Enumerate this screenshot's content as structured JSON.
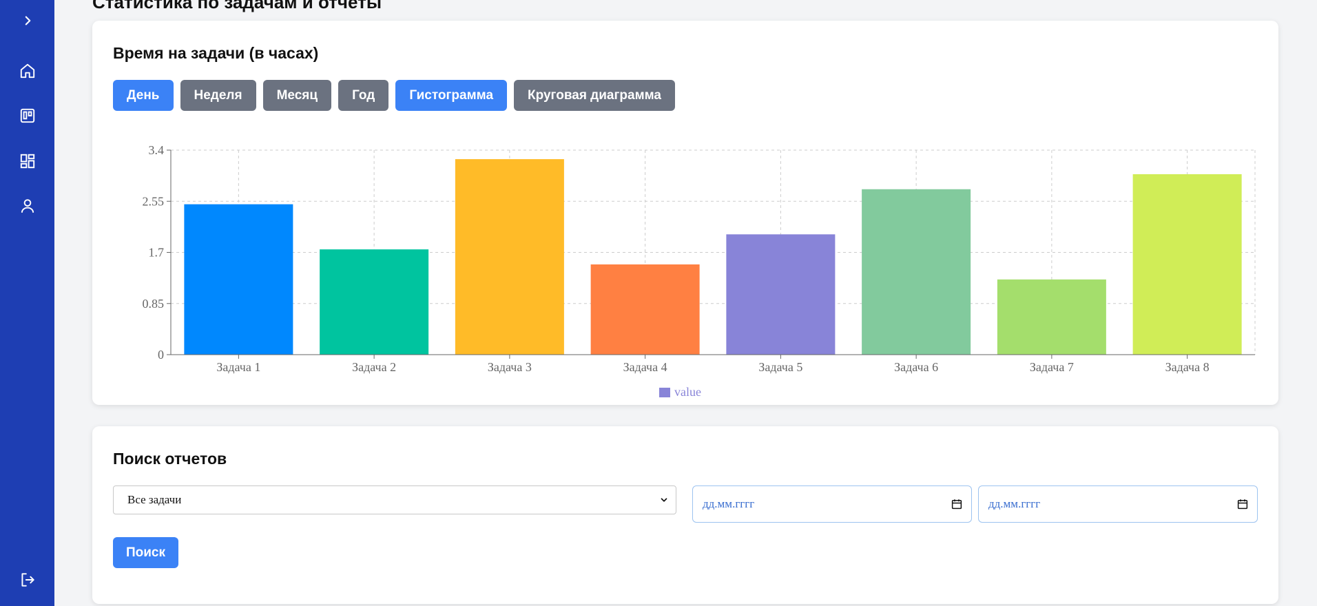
{
  "sidebar": {
    "items": [
      {
        "icon": "chevron-right-icon"
      },
      {
        "icon": "home-icon"
      },
      {
        "icon": "board-icon"
      },
      {
        "icon": "dashboard-icon"
      },
      {
        "icon": "user-icon"
      },
      {
        "icon": "logout-icon"
      }
    ],
    "bg_color": "#1e3eb3"
  },
  "page": {
    "heading": "Статистика по задачам и отчеты"
  },
  "chart_card": {
    "title": "Время на задачи (в часах)",
    "period_buttons": [
      {
        "label": "День",
        "active": true
      },
      {
        "label": "Неделя",
        "active": false
      },
      {
        "label": "Месяц",
        "active": false
      },
      {
        "label": "Год",
        "active": false
      }
    ],
    "view_buttons": [
      {
        "label": "Гистограмма",
        "active": true
      },
      {
        "label": "Круговая диаграмма",
        "active": false
      }
    ]
  },
  "chart_data": {
    "type": "bar",
    "categories": [
      "Задача 1",
      "Задача 2",
      "Задача 3",
      "Задача 4",
      "Задача 5",
      "Задача 6",
      "Задача 7",
      "Задача 8"
    ],
    "series": [
      {
        "name": "value",
        "values": [
          2.5,
          1.75,
          3.25,
          1.5,
          2.0,
          2.75,
          1.25,
          3.0
        ]
      }
    ],
    "bar_colors": [
      "#0088fe",
      "#00c49f",
      "#ffbb28",
      "#ff8042",
      "#8884d8",
      "#82ca9d",
      "#a4de6c",
      "#d0ed57"
    ],
    "legend_color": "#8884d8",
    "yticks": [
      0,
      0.85,
      1.7,
      2.55,
      3.4
    ],
    "ylim": [
      0,
      3.4
    ],
    "grid": true,
    "legend": "bottom-center"
  },
  "search_card": {
    "title": "Поиск отчетов",
    "select_value": "Все задачи",
    "date_from_placeholder": "дд.мм.гггг",
    "date_to_placeholder": "дд.мм.гггг",
    "search_button": "Поиск"
  }
}
